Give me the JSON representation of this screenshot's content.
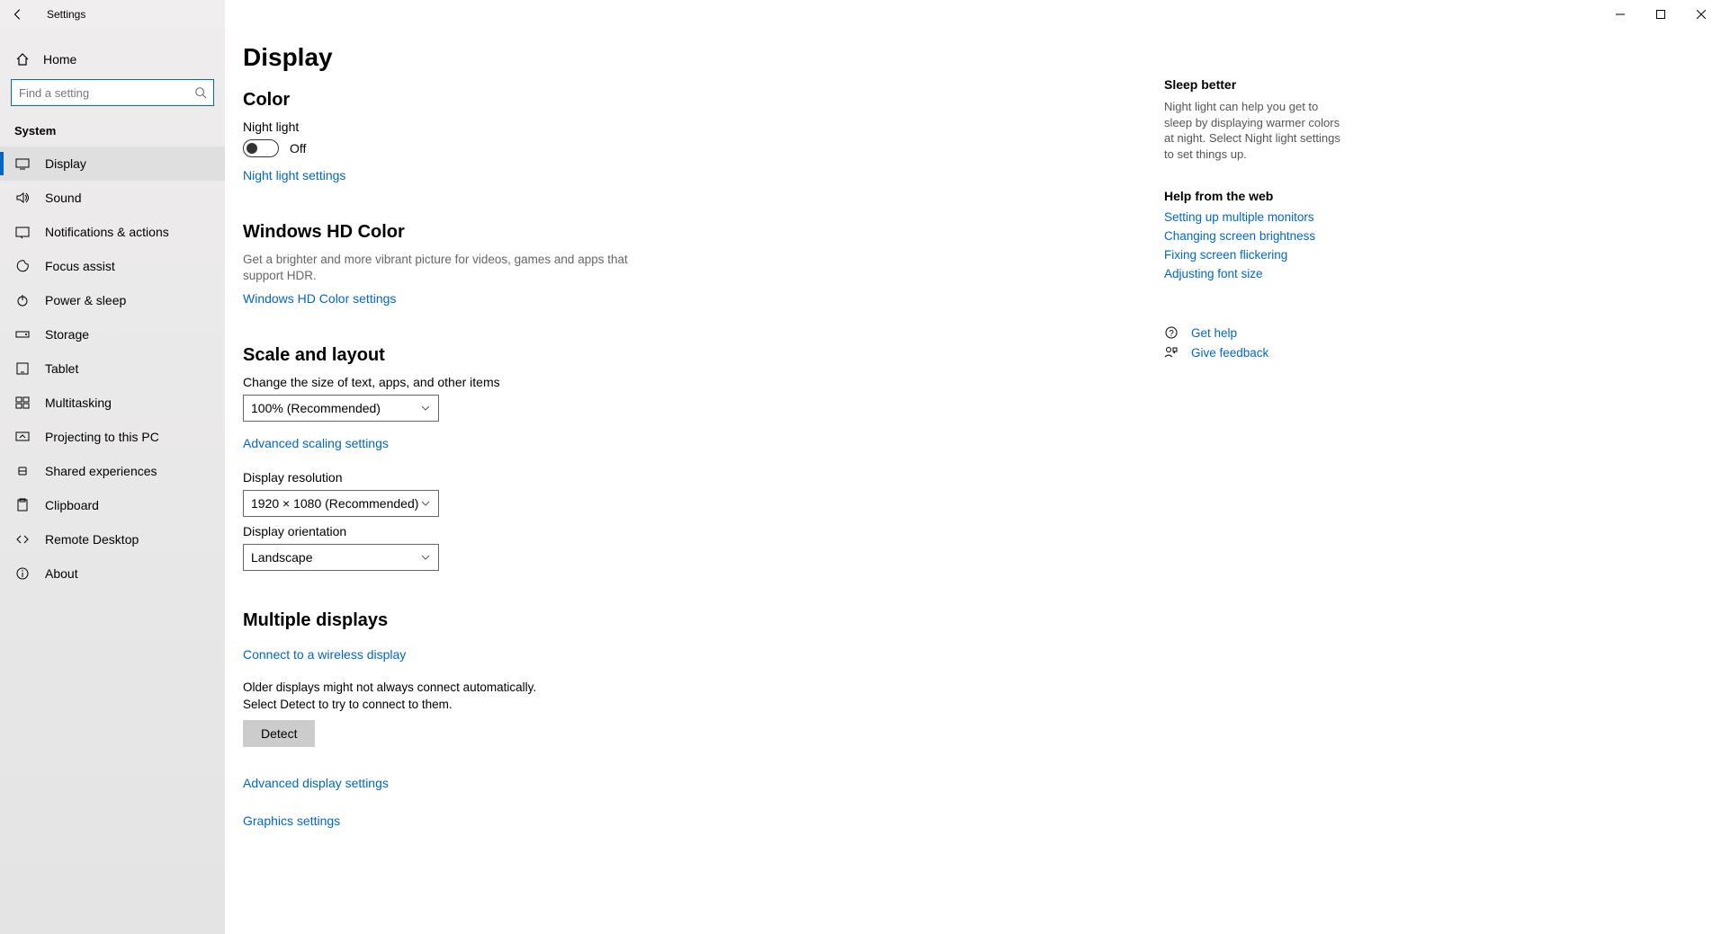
{
  "window": {
    "title": "Settings"
  },
  "sidebar": {
    "home_label": "Home",
    "search_placeholder": "Find a setting",
    "section_label": "System",
    "items": [
      {
        "label": "Display",
        "icon": "display-icon",
        "active": true
      },
      {
        "label": "Sound",
        "icon": "sound-icon"
      },
      {
        "label": "Notifications & actions",
        "icon": "notifications-icon"
      },
      {
        "label": "Focus assist",
        "icon": "focus-assist-icon"
      },
      {
        "label": "Power & sleep",
        "icon": "power-icon"
      },
      {
        "label": "Storage",
        "icon": "storage-icon"
      },
      {
        "label": "Tablet",
        "icon": "tablet-icon"
      },
      {
        "label": "Multitasking",
        "icon": "multitasking-icon"
      },
      {
        "label": "Projecting to this PC",
        "icon": "projecting-icon"
      },
      {
        "label": "Shared experiences",
        "icon": "shared-icon"
      },
      {
        "label": "Clipboard",
        "icon": "clipboard-icon"
      },
      {
        "label": "Remote Desktop",
        "icon": "remote-icon"
      },
      {
        "label": "About",
        "icon": "about-icon"
      }
    ]
  },
  "page": {
    "title": "Display",
    "color": {
      "heading": "Color",
      "night_light_label": "Night light",
      "night_light_state": "Off",
      "night_light_settings_link": "Night light settings"
    },
    "hdcolor": {
      "heading": "Windows HD Color",
      "desc": "Get a brighter and more vibrant picture for videos, games and apps that support HDR.",
      "link": "Windows HD Color settings"
    },
    "scale": {
      "heading": "Scale and layout",
      "text_size_label": "Change the size of text, apps, and other items",
      "text_size_value": "100% (Recommended)",
      "advanced_scaling_link": "Advanced scaling settings",
      "resolution_label": "Display resolution",
      "resolution_value": "1920 × 1080 (Recommended)",
      "orientation_label": "Display orientation",
      "orientation_value": "Landscape"
    },
    "multi": {
      "heading": "Multiple displays",
      "connect_link": "Connect to a wireless display",
      "detect_desc": "Older displays might not always connect automatically. Select Detect to try to connect to them.",
      "detect_button": "Detect",
      "advanced_link": "Advanced display settings",
      "graphics_link": "Graphics settings"
    }
  },
  "right_panel": {
    "sleep_heading": "Sleep better",
    "sleep_text": "Night light can help you get to sleep by displaying warmer colors at night. Select Night light settings to set things up.",
    "help_heading": "Help from the web",
    "help_links": [
      "Setting up multiple monitors",
      "Changing screen brightness",
      "Fixing screen flickering",
      "Adjusting font size"
    ],
    "get_help": "Get help",
    "give_feedback": "Give feedback"
  }
}
